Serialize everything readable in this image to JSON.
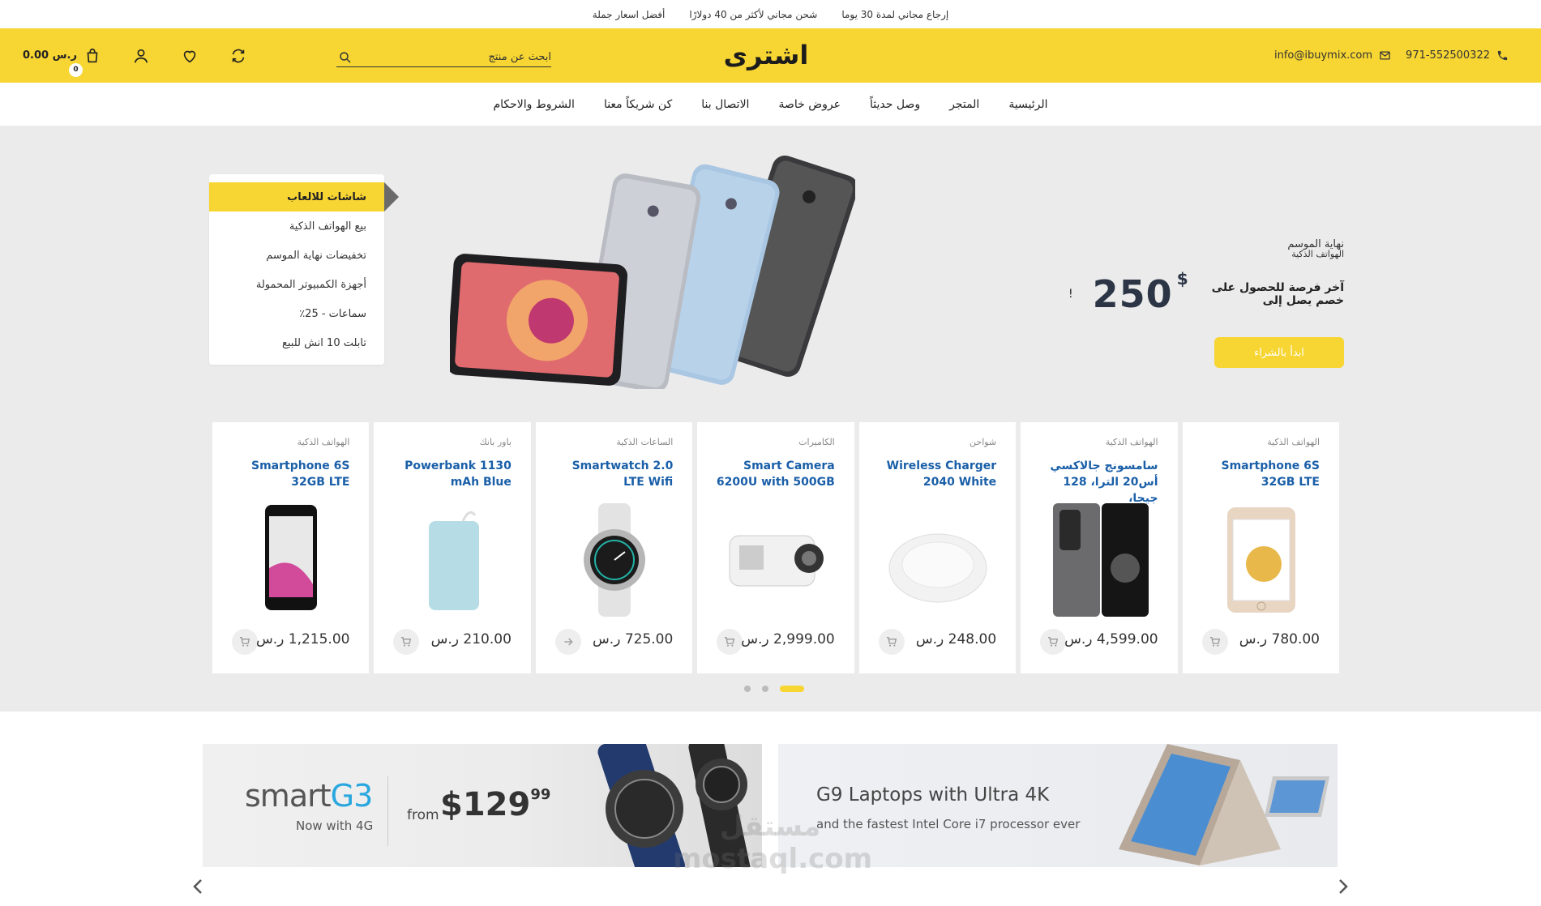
{
  "topbar": {
    "items": [
      "إرجاع مجاني لمدة 30 يوما",
      "شحن مجاني لأكثر من 40 دولارًا",
      "أفضل اسعار جملة"
    ]
  },
  "header": {
    "phone": "971-552500322",
    "email": "info@ibuymix.com",
    "logo_text": "اشترى",
    "search_placeholder": "ابحث عن منتج",
    "cart_total": "0.00 ر.س",
    "cart_count": "0"
  },
  "nav": {
    "items": [
      "الرئيسية",
      "المتجر",
      "وصل حديثاً",
      "عروض خاصة",
      "الاتصال بنا",
      "كن شريكاً معنا",
      "الشروط والاحكام"
    ]
  },
  "categories": {
    "active": "شاشات للالعاب",
    "items": [
      "بيع الهواتف الذكية",
      "تخفيضات نهاية الموسم",
      "أجهزة الكمبيوتر المحمولة",
      "سماعات - 25٪",
      "تابلت 10 انش للبيع"
    ]
  },
  "promo": {
    "line1": "نهاية الموسم",
    "line2": "الهواتف الذكية",
    "deal_text": "آخر فرصة للحصول على خصم يصل إلى",
    "price": "250",
    "currency": "$",
    "exclaim": "!",
    "button": "ابدأ بالشراء"
  },
  "products": [
    {
      "category": "الهواتف الذكية",
      "title": "Smartphone 6S 32GB LTE",
      "price": "780.00 ر.س",
      "image": "iphone-gold"
    },
    {
      "category": "الهواتف الذكية",
      "title": "سامسونج جالاكسي أس20 الترا، 128 جيجا،",
      "price": "4,599.00 ر.س",
      "image": "galaxy-s20"
    },
    {
      "category": "شواحن",
      "title": "Wireless Charger 2040 White",
      "price": "248.00 ر.س",
      "image": "wireless-charger"
    },
    {
      "category": "الكاميرات",
      "title": "Smart Camera 6200U with 500GB",
      "price": "2,999.00 ر.س",
      "image": "action-camera"
    },
    {
      "category": "الساعات الذكية",
      "title": "Smartwatch 2.0 LTE Wifi",
      "price": "725.00 ر.س",
      "image": "smartwatch"
    },
    {
      "category": "باور بانك",
      "title": "Powerbank 1130 mAh Blue",
      "price": "210.00 ر.س",
      "image": "powerbank"
    },
    {
      "category": "الهواتف الذكية",
      "title": "Smartphone 6S 32GB LTE",
      "price": "1,215.00 ر.س",
      "image": "lg-phone"
    }
  ],
  "banners": {
    "b1_brand_a": "smart",
    "b1_brand_b": "G3",
    "b1_sub": "Now with 4G",
    "b1_from": "from",
    "b1_price": "$129",
    "b1_cents": "99",
    "b2_title": "G9 Laptops with Ultra 4K",
    "b2_sub": "and the fastest Intel Core i7 processor ever"
  },
  "watermark": {
    "line1": "مستقل",
    "line2": "mostaql.com"
  },
  "colors": {
    "brand_yellow": "#f7d532",
    "link_blue": "#1a5fa8",
    "hero_bg": "#ebebeb"
  }
}
